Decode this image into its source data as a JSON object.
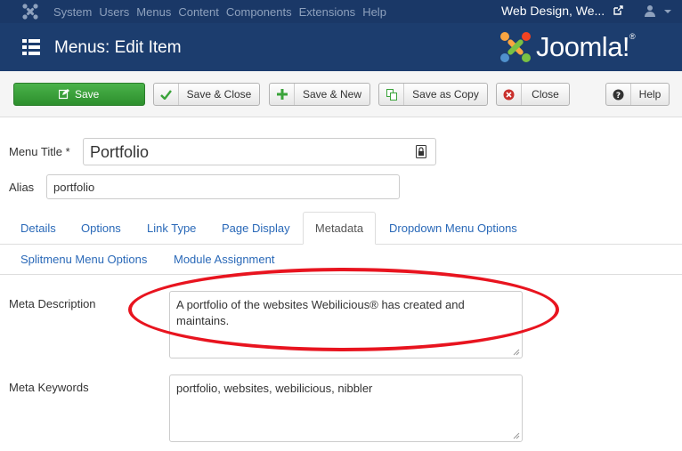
{
  "topnav": {
    "items": [
      "System",
      "Users",
      "Menus",
      "Content",
      "Components",
      "Extensions",
      "Help"
    ],
    "site_name": "Web Design, We..."
  },
  "header": {
    "title": "Menus: Edit Item",
    "brand": "Joomla!",
    "brand_mark": "®"
  },
  "toolbar": {
    "save": "Save",
    "save_close": "Save & Close",
    "save_new": "Save & New",
    "save_copy": "Save as Copy",
    "close": "Close",
    "help": "Help"
  },
  "form": {
    "menu_title_label": "Menu Title *",
    "menu_title_value": "Portfolio",
    "alias_label": "Alias",
    "alias_value": "portfolio",
    "meta_description_label": "Meta Description",
    "meta_description_value": "A portfolio of the websites Webilicious® has created and maintains.",
    "meta_keywords_label": "Meta Keywords",
    "meta_keywords_value": "portfolio, websites, webilicious, nibbler"
  },
  "tabs": [
    "Details",
    "Options",
    "Link Type",
    "Page Display",
    "Metadata",
    "Dropdown Menu Options",
    "Splitmenu Menu Options",
    "Module Assignment"
  ],
  "colors": {
    "nav_bg": "#1a3867",
    "header_bg": "#1c3d6e",
    "save_green": "#3aa33a",
    "link_blue": "#2a69b8",
    "annotation_red": "#e8141f"
  }
}
